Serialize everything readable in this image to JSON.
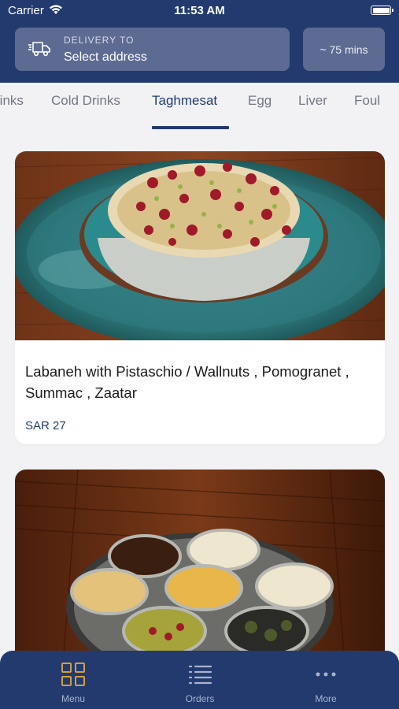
{
  "status_bar": {
    "carrier": "Carrier",
    "time": "11:53 AM"
  },
  "header": {
    "delivery_label": "DELIVERY TO",
    "address": "Select address",
    "eta": "~ 75 mins"
  },
  "tabs": [
    {
      "label": "rinks"
    },
    {
      "label": "Cold Drinks"
    },
    {
      "label": "Taghmesat",
      "active": true
    },
    {
      "label": "Egg"
    },
    {
      "label": "Liver"
    },
    {
      "label": "Foul"
    }
  ],
  "items": [
    {
      "title": "Labaneh with Pistaschio / Wallnuts , Pomogranet , Summac , Zaatar",
      "price": "SAR 27"
    },
    {
      "title": "",
      "price": ""
    }
  ],
  "bottom_nav": [
    {
      "label": "Menu",
      "icon": "grid-icon"
    },
    {
      "label": "Orders",
      "icon": "list-icon"
    },
    {
      "label": "More",
      "icon": "ellipsis-icon"
    }
  ],
  "colors": {
    "brand": "#223a6e",
    "button": "#5d6b93",
    "background": "#f2f2f4"
  }
}
